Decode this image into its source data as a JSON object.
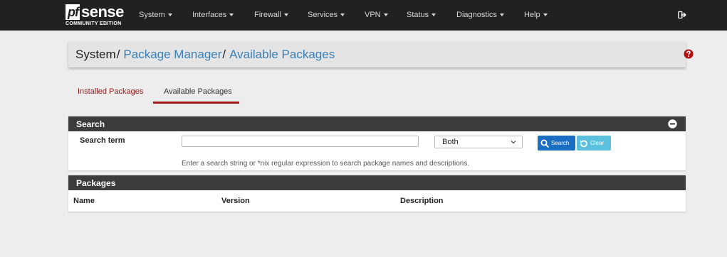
{
  "brand": {
    "pf": "pf",
    "sense": "sense",
    "subtitle": "COMMUNITY EDITION"
  },
  "nav": {
    "items": [
      "System",
      "Interfaces",
      "Firewall",
      "Services",
      "VPN",
      "Status",
      "Diagnostics",
      "Help"
    ],
    "logout_icon": "sign-out-icon"
  },
  "breadcrumb": {
    "root": "System",
    "separator": "/",
    "level1": "Package Manager",
    "level2": "Available Packages"
  },
  "tabs": {
    "installed": "Installed Packages",
    "available": "Available Packages",
    "active": "Available Packages"
  },
  "search_panel": {
    "title": "Search",
    "term_label": "Search term",
    "term_value": "",
    "term_placeholder": "",
    "scope_selected": "Both",
    "search_button": "Search",
    "clear_button": "Clear",
    "help_text": "Enter a search string or *nix regular expression to search package names and descriptions."
  },
  "packages_panel": {
    "title": "Packages",
    "columns": [
      "Name",
      "Version",
      "Description"
    ]
  },
  "colors": {
    "navbar": "#212121",
    "link": "#3a7fb5",
    "tab_accent": "#a31818",
    "panel_heading": "#3c3c3c",
    "search_button": "#1b6fc2",
    "clear_button": "#5bc0de",
    "help_icon": "#b30e0e"
  }
}
